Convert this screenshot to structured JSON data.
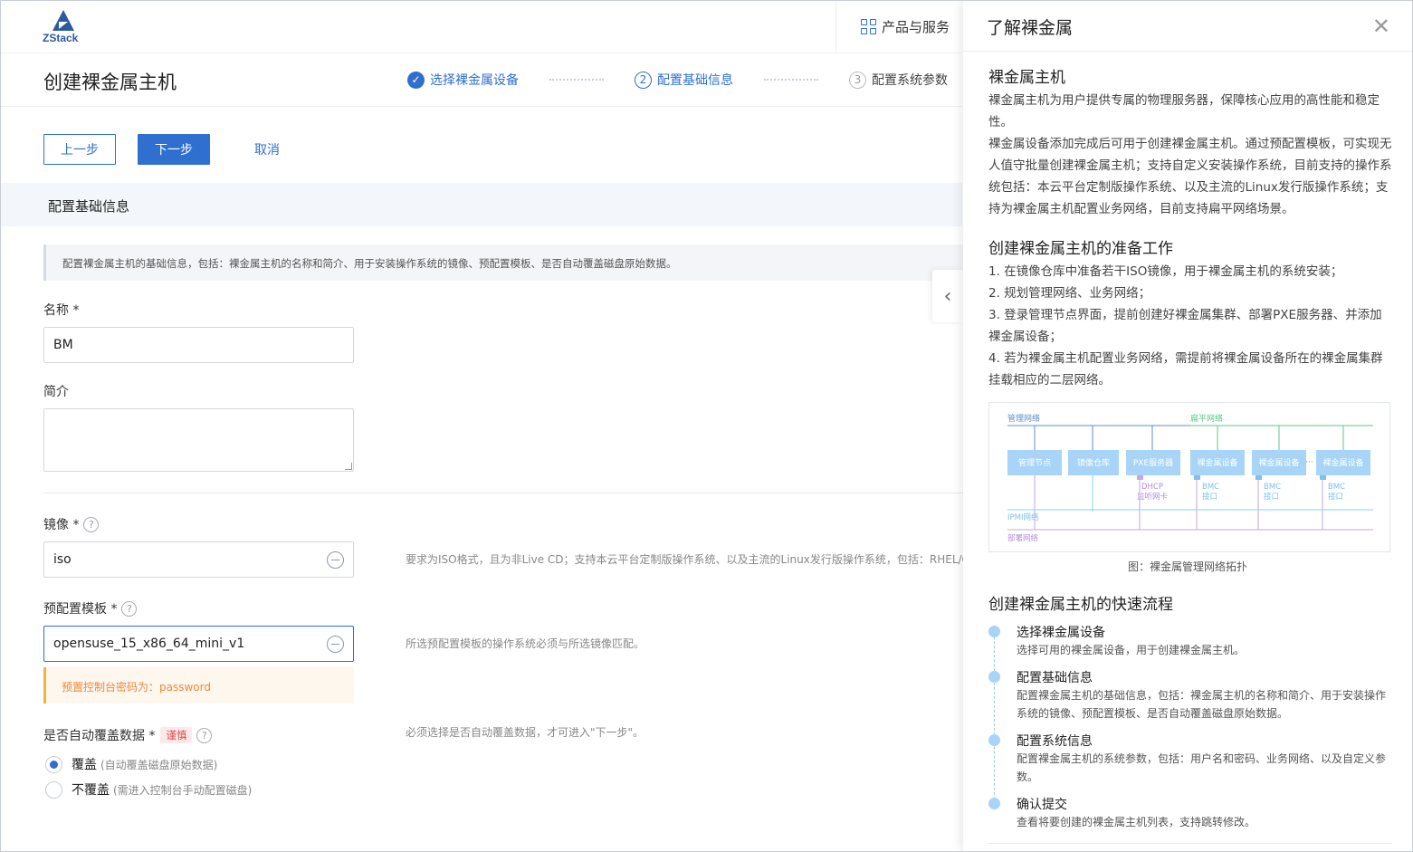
{
  "app": {
    "logo_text": "ZStack",
    "products_label": "产品与服务"
  },
  "page": {
    "title": "创建裸金属主机",
    "steps": [
      {
        "index": "✓",
        "label": "选择裸金属设备",
        "state": "done"
      },
      {
        "index": "2",
        "label": "配置基础信息",
        "state": "active"
      },
      {
        "index": "3",
        "label": "配置系统参数",
        "state": "pending"
      }
    ],
    "buttons": {
      "prev": "上一步",
      "next": "下一步",
      "cancel": "取消"
    },
    "section_title": "配置基础信息",
    "info_text": "配置裸金属主机的基础信息，包括：裸金属主机的名称和简介、用于安装操作系统的镜像、预配置模板、是否自动覆盖磁盘原始数据。"
  },
  "form": {
    "name_label": "名称 *",
    "name_value": "BM",
    "desc_label": "简介",
    "image_label": "镜像 *",
    "image_value": "iso",
    "image_hint": "要求为ISO格式，且为非Live CD；支持本云平台定制版操作系统、以及主流的Linux发行版操作系统，包括：RHEL/C",
    "template_label": "预配置模板 *",
    "template_value": "opensuse_15_x86_64_mini_v1",
    "template_hint": "所选预配置模板的操作系统必须与所选镜像匹配。",
    "template_warning": "预置控制台密码为：password",
    "overwrite_label": "是否自动覆盖数据 *",
    "overwrite_tag": "谨慎",
    "overwrite_hint": "必须选择是否自动覆盖数据，才可进入\"下一步\"。",
    "options": [
      {
        "label": "覆盖",
        "sub": "(自动覆盖磁盘原始数据)",
        "selected": true
      },
      {
        "label": "不覆盖",
        "sub": "(需进入控制台手动配置磁盘)",
        "selected": false
      }
    ]
  },
  "panel": {
    "title": "了解裸金属",
    "s1_title": "裸金属主机",
    "s1_p1": "裸金属主机为用户提供专属的物理服务器，保障核心应用的高性能和稳定性。",
    "s1_p2": "裸金属设备添加完成后可用于创建裸金属主机。通过预配置模板，可实现无人值守批量创建裸金属主机；支持自定义安装操作系统，目前支持的操作系统包括：本云平台定制版操作系统、以及主流的Linux发行版操作系统；支持为裸金属主机配置业务网络，目前支持扁平网络场景。",
    "s2_title": "创建裸金属主机的准备工作",
    "s2_items": [
      "1. 在镜像仓库中准备若干ISO镜像，用于裸金属主机的系统安装；",
      "2. 规划管理网络、业务网络；",
      "3. 登录管理节点界面，提前创建好裸金属集群、部署PXE服务器、并添加裸金属设备；",
      "4. 若为裸金属主机配置业务网络，需提前将裸金属设备所在的裸金属集群挂载相应的二层网络。"
    ],
    "diagram": {
      "mgmt_net": "管理网络",
      "flat_net": "扁平网络",
      "nodes": [
        "管理节点",
        "镜像仓库",
        "PXE服务器",
        "裸金属设备",
        "裸金属设备",
        "裸金属设备"
      ],
      "ellipsis": "···",
      "dhcp_l1": "DHCP",
      "dhcp_l2": "监听网卡",
      "bmc_l1": "BMC",
      "bmc_l2": "接口",
      "ipmi_net": "IPMI网络",
      "deploy_net": "部署网络",
      "caption": "图：裸金属管理网络拓扑"
    },
    "s3_title": "创建裸金属主机的快速流程",
    "flow": [
      {
        "title": "选择裸金属设备",
        "desc": "选择可用的裸金属设备，用于创建裸金属主机。"
      },
      {
        "title": "配置基础信息",
        "desc": "配置裸金属主机的基础信息，包括：裸金属主机的名称和简介、用于安装操作系统的镜像、预配置模板、是否自动覆盖磁盘原始数据。"
      },
      {
        "title": "配置系统信息",
        "desc": "配置裸金属主机的系统参数，包括：用户名和密码、业务网络、以及自定义参数。"
      },
      {
        "title": "确认提交",
        "desc": "查看将要创建的裸金属主机列表，支持跳转修改。"
      }
    ]
  },
  "colors": {
    "accent": "#2f6fd0",
    "warning": "#f0883a",
    "danger": "#e5484d",
    "diagram_node": "#a8d4f7",
    "mgmt_line": "#5b8fc9",
    "flat_line": "#5cc98a",
    "deploy_line": "#c4a6e6"
  }
}
